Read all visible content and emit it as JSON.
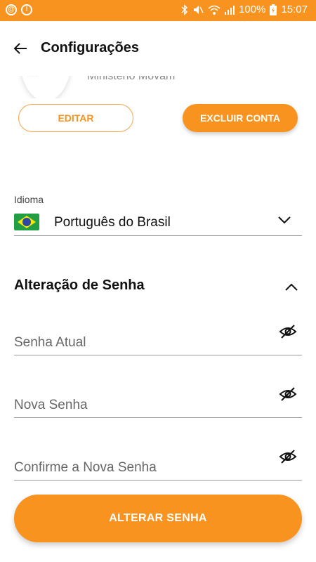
{
  "status_bar": {
    "battery": "100%",
    "time": "15:07",
    "icons": [
      "at-sign-icon",
      "info-icon",
      "bluetooth-icon",
      "mute-icon",
      "wifi-icon",
      "signal-icon",
      "battery-icon"
    ]
  },
  "header": {
    "title": "Configurações",
    "back_icon": "arrow-left-icon"
  },
  "profile": {
    "avatar_text": "***",
    "subtitle": "Ministério Movam"
  },
  "actions": {
    "edit_label": "EDITAR",
    "delete_label": "EXCLUIR CONTA"
  },
  "language": {
    "label": "Idioma",
    "value": "Português do Brasil",
    "flag": "brazil-flag-icon"
  },
  "password_section": {
    "title": "Alteração de Senha",
    "fields": [
      {
        "placeholder": "Senha Atual",
        "value": ""
      },
      {
        "placeholder": "Nova Senha",
        "value": ""
      },
      {
        "placeholder": "Confirme a Nova Senha",
        "value": ""
      }
    ],
    "submit_label": "ALTERAR SENHA"
  },
  "colors": {
    "accent": "#f7931e",
    "background": "#ffffff",
    "text": "#111111"
  }
}
